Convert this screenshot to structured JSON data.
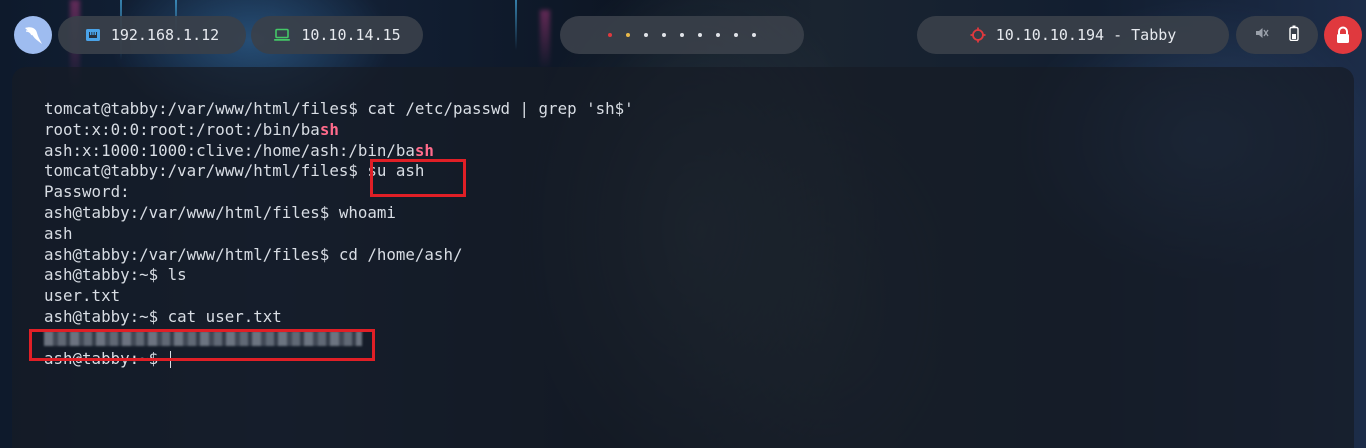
{
  "topbar": {
    "logo_icon": "kali-dragon-icon",
    "host_ip": "192.168.1.12",
    "host_icon": "ethernet-icon",
    "vpn_ip": "10.10.14.15",
    "vpn_icon": "laptop-icon",
    "workspaces": {
      "count": 9,
      "colors": [
        "#e0393e",
        "#e8b84a",
        "#e0e3e8",
        "#e0e3e8",
        "#e0e3e8",
        "#e0e3e8",
        "#e0e3e8",
        "#e0e3e8",
        "#e0e3e8"
      ]
    },
    "target": "10.10.10.194 - Tabby",
    "target_icon": "crosshair-icon",
    "target_color": "#e0393e",
    "mute_icon": "speaker-muted-icon",
    "battery_icon": "battery-icon",
    "lock_icon": "lock-icon",
    "lock_color": "#e0393e"
  },
  "terminal": {
    "lines": [
      {
        "text": "tomcat@tabby:/var/www/html/files$ cat /etc/passwd | grep 'sh$'"
      },
      {
        "text": "root:x:0:0:root:/root:/bin/ba",
        "hl": "sh"
      },
      {
        "text": "ash:x:1000:1000:clive:/home/ash:/bin/ba",
        "hl": "sh"
      },
      {
        "text": "tomcat@tabby:/var/www/html/files$ su ash"
      },
      {
        "text": "Password:"
      },
      {
        "text": "ash@tabby:/var/www/html/files$ whoami"
      },
      {
        "text": "ash"
      },
      {
        "text": "ash@tabby:/var/www/html/files$ cd /home/ash/"
      },
      {
        "text": "ash@tabby:~$ ls"
      },
      {
        "text": "user.txt"
      },
      {
        "text": "ash@tabby:~$ cat user.txt"
      },
      {
        "text": "",
        "redacted": true
      },
      {
        "text": "ash@tabby:~$ ",
        "cursor": true
      }
    ],
    "highlight_color": "#ff6b8b",
    "annotation_color": "#e01f26"
  }
}
